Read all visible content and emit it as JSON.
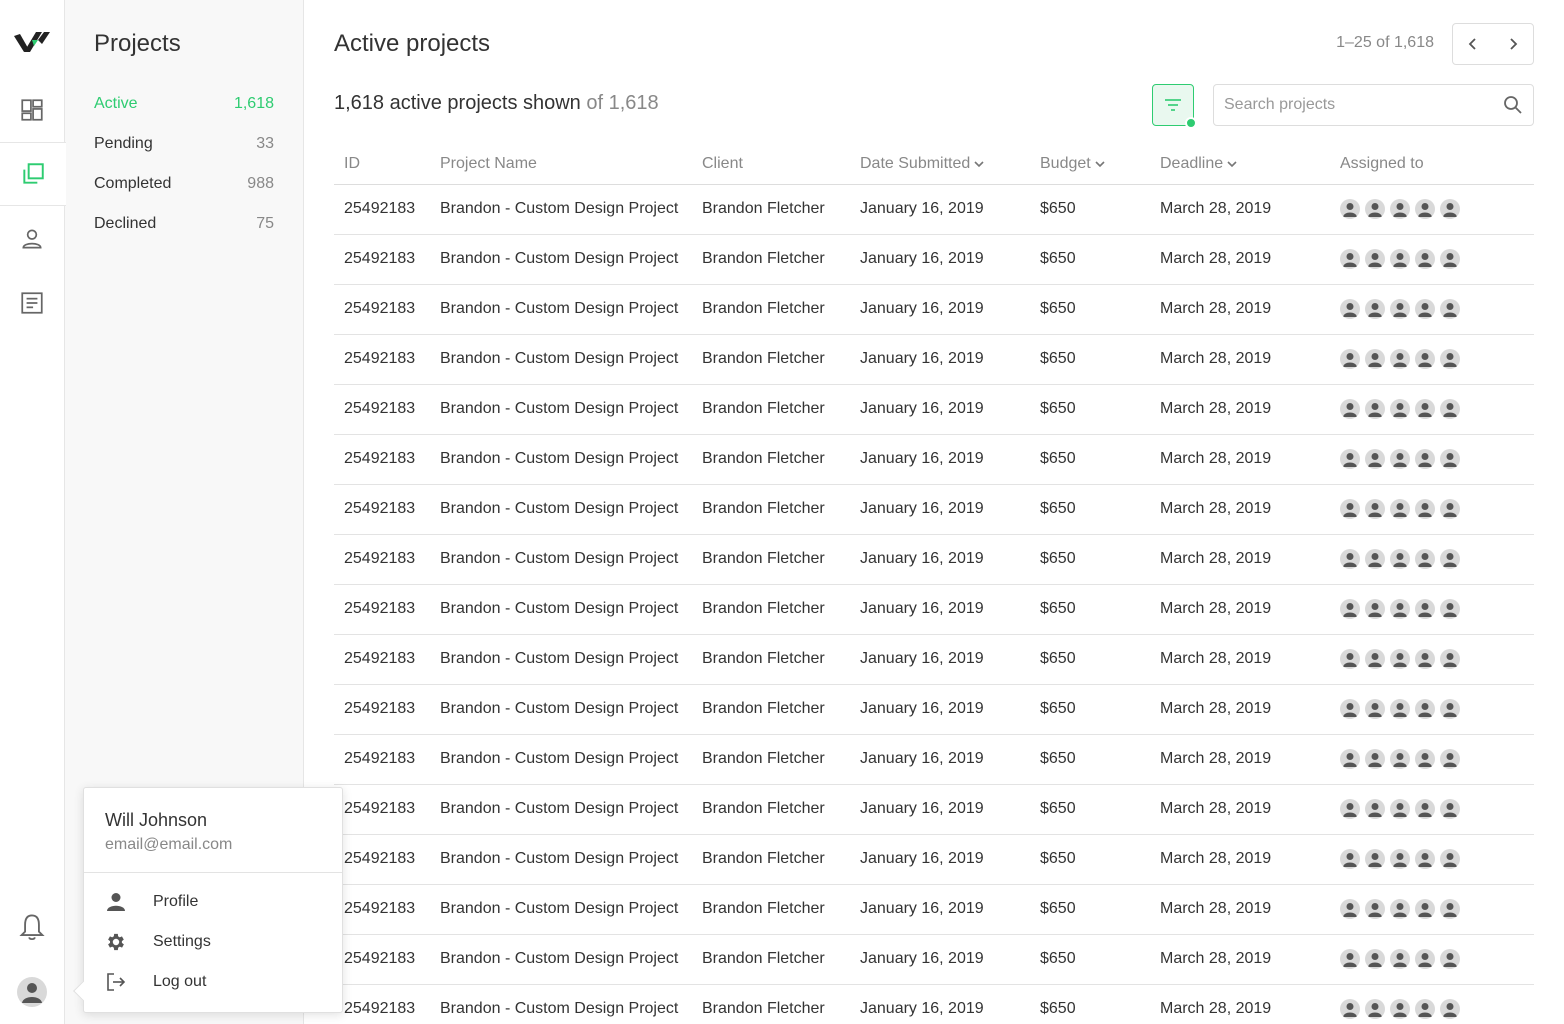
{
  "colors": {
    "accent": "#2ecc71",
    "icon": "#666666",
    "muted": "#888888"
  },
  "rail": {
    "items": [
      {
        "name": "dashboard-icon"
      },
      {
        "name": "projects-icon",
        "active": true
      },
      {
        "name": "person-icon"
      },
      {
        "name": "document-icon"
      }
    ],
    "bottom": [
      {
        "name": "bell-icon"
      },
      {
        "name": "avatar"
      }
    ]
  },
  "sidebar": {
    "title": "Projects",
    "items": [
      {
        "label": "Active",
        "count": "1,618",
        "active": true
      },
      {
        "label": "Pending",
        "count": "33"
      },
      {
        "label": "Completed",
        "count": "988"
      },
      {
        "label": "Declined",
        "count": "75"
      }
    ]
  },
  "main": {
    "title": "Active projects",
    "pager_text": "1–25 of 1,618",
    "shown_text": "1,618 active projects shown",
    "shown_of": "of 1,618",
    "search_placeholder": "Search projects",
    "columns": [
      "ID",
      "Project Name",
      "Client",
      "Date Submitted",
      "Budget",
      "Deadline",
      "Assigned to"
    ],
    "sortable_columns": [
      "Date Submitted",
      "Budget",
      "Deadline"
    ],
    "rows": [
      {
        "id": "25492183",
        "name": "Brandon - Custom Design Project",
        "client": "Brandon Fletcher",
        "date": "January 16, 2019",
        "budget": "$650",
        "deadline": "March 28, 2019",
        "assigned": 5
      },
      {
        "id": "25492183",
        "name": "Brandon - Custom Design Project",
        "client": "Brandon Fletcher",
        "date": "January 16, 2019",
        "budget": "$650",
        "deadline": "March 28, 2019",
        "assigned": 5
      },
      {
        "id": "25492183",
        "name": "Brandon - Custom Design Project",
        "client": "Brandon Fletcher",
        "date": "January 16, 2019",
        "budget": "$650",
        "deadline": "March 28, 2019",
        "assigned": 5
      },
      {
        "id": "25492183",
        "name": "Brandon - Custom Design Project",
        "client": "Brandon Fletcher",
        "date": "January 16, 2019",
        "budget": "$650",
        "deadline": "March 28, 2019",
        "assigned": 5
      },
      {
        "id": "25492183",
        "name": "Brandon - Custom Design Project",
        "client": "Brandon Fletcher",
        "date": "January 16, 2019",
        "budget": "$650",
        "deadline": "March 28, 2019",
        "assigned": 5
      },
      {
        "id": "25492183",
        "name": "Brandon - Custom Design Project",
        "client": "Brandon Fletcher",
        "date": "January 16, 2019",
        "budget": "$650",
        "deadline": "March 28, 2019",
        "assigned": 5
      },
      {
        "id": "25492183",
        "name": "Brandon - Custom Design Project",
        "client": "Brandon Fletcher",
        "date": "January 16, 2019",
        "budget": "$650",
        "deadline": "March 28, 2019",
        "assigned": 5
      },
      {
        "id": "25492183",
        "name": "Brandon - Custom Design Project",
        "client": "Brandon Fletcher",
        "date": "January 16, 2019",
        "budget": "$650",
        "deadline": "March 28, 2019",
        "assigned": 5
      },
      {
        "id": "25492183",
        "name": "Brandon - Custom Design Project",
        "client": "Brandon Fletcher",
        "date": "January 16, 2019",
        "budget": "$650",
        "deadline": "March 28, 2019",
        "assigned": 5
      },
      {
        "id": "25492183",
        "name": "Brandon - Custom Design Project",
        "client": "Brandon Fletcher",
        "date": "January 16, 2019",
        "budget": "$650",
        "deadline": "March 28, 2019",
        "assigned": 5
      },
      {
        "id": "25492183",
        "name": "Brandon - Custom Design Project",
        "client": "Brandon Fletcher",
        "date": "January 16, 2019",
        "budget": "$650",
        "deadline": "March 28, 2019",
        "assigned": 5
      },
      {
        "id": "25492183",
        "name": "Brandon - Custom Design Project",
        "client": "Brandon Fletcher",
        "date": "January 16, 2019",
        "budget": "$650",
        "deadline": "March 28, 2019",
        "assigned": 5
      },
      {
        "id": "25492183",
        "name": "Brandon - Custom Design Project",
        "client": "Brandon Fletcher",
        "date": "January 16, 2019",
        "budget": "$650",
        "deadline": "March 28, 2019",
        "assigned": 5
      },
      {
        "id": "25492183",
        "name": "Brandon - Custom Design Project",
        "client": "Brandon Fletcher",
        "date": "January 16, 2019",
        "budget": "$650",
        "deadline": "March 28, 2019",
        "assigned": 5
      },
      {
        "id": "25492183",
        "name": "Brandon - Custom Design Project",
        "client": "Brandon Fletcher",
        "date": "January 16, 2019",
        "budget": "$650",
        "deadline": "March 28, 2019",
        "assigned": 5
      },
      {
        "id": "25492183",
        "name": "Brandon - Custom Design Project",
        "client": "Brandon Fletcher",
        "date": "January 16, 2019",
        "budget": "$650",
        "deadline": "March 28, 2019",
        "assigned": 5
      },
      {
        "id": "25492183",
        "name": "Brandon - Custom Design Project",
        "client": "Brandon Fletcher",
        "date": "January 16, 2019",
        "budget": "$650",
        "deadline": "March 28, 2019",
        "assigned": 5
      }
    ]
  },
  "user_menu": {
    "name": "Will Johnson",
    "email": "email@email.com",
    "items": [
      {
        "label": "Profile",
        "icon": "person-icon"
      },
      {
        "label": "Settings",
        "icon": "gear-icon"
      },
      {
        "label": "Log out",
        "icon": "logout-icon"
      }
    ]
  }
}
